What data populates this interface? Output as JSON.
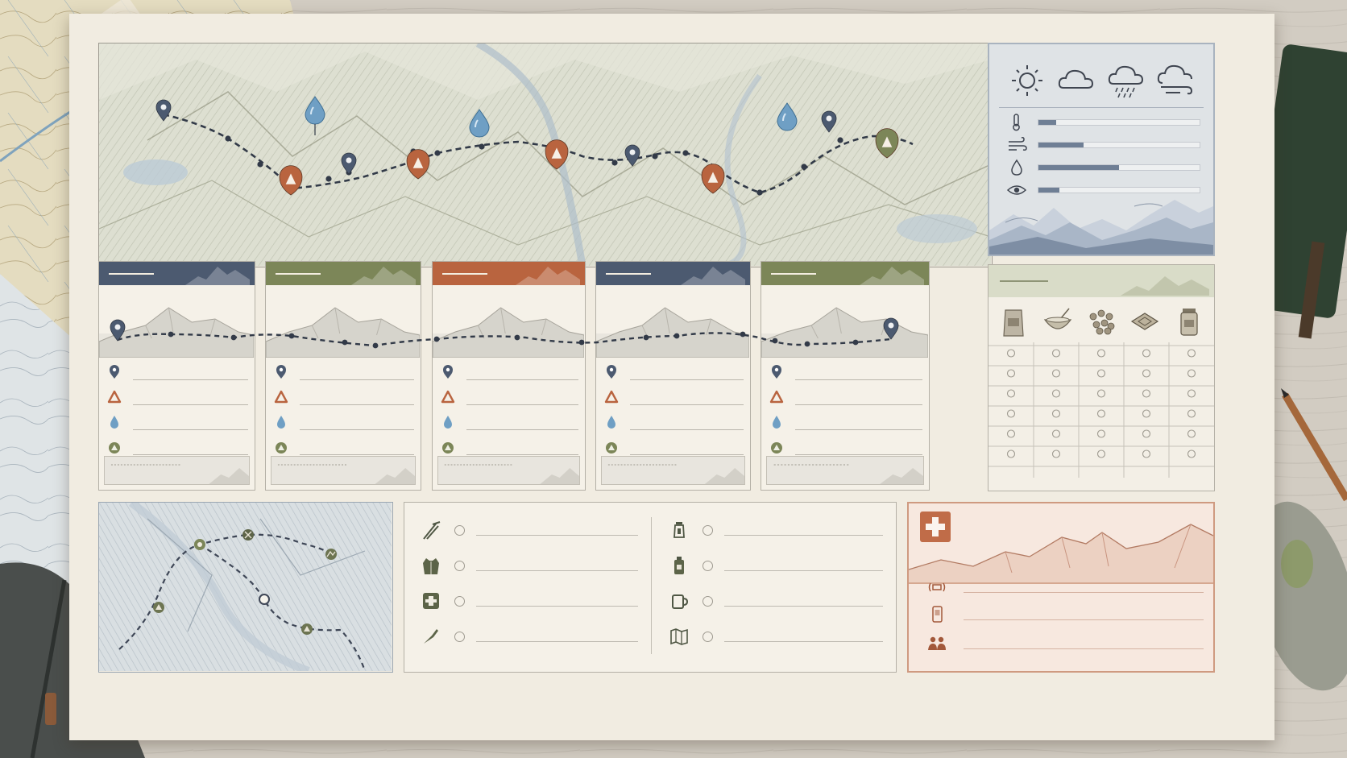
{
  "palette": {
    "navy": "#4c5a70",
    "olive": "#7c8658",
    "rust": "#b9643f",
    "water": "#6f9fc4",
    "paper": "#f1ece1",
    "emergency": "#c06c48"
  },
  "icons": {
    "weather": [
      "sun-icon",
      "cloud-icon",
      "rain-cloud-icon",
      "wind-cloud-icon"
    ],
    "stats": [
      "thermometer-icon",
      "wind-icon",
      "humidity-drop-icon",
      "visibility-eye-icon"
    ],
    "day_rows": [
      "waypoint-pin-icon",
      "camp-tent-icon",
      "water-drop-icon",
      "terrain-icon"
    ],
    "food": [
      "food-bag-icon",
      "bowl-icon",
      "trail-mix-icon",
      "energy-bar-icon",
      "jar-icon"
    ],
    "gear_left": [
      "trekking-poles-icon",
      "jacket-icon",
      "first-aid-icon",
      "knife-icon"
    ],
    "gear_right": [
      "lantern-icon",
      "fuel-canister-icon",
      "mug-icon",
      "map-icon"
    ],
    "emergency": [
      "first-aid-cross-icon",
      "radio-beacon-icon",
      "phone-icon",
      "group-icon"
    ]
  },
  "weather_levels": {
    "temperature": 0.11,
    "wind": 0.28,
    "humidity": 0.5,
    "visibility": 0.13
  },
  "day_headers": [
    "#4c5a70",
    "#7c8658",
    "#b9643f",
    "#4c5a70",
    "#7c8658"
  ],
  "food_grid": {
    "columns": 5,
    "rows": 6
  }
}
